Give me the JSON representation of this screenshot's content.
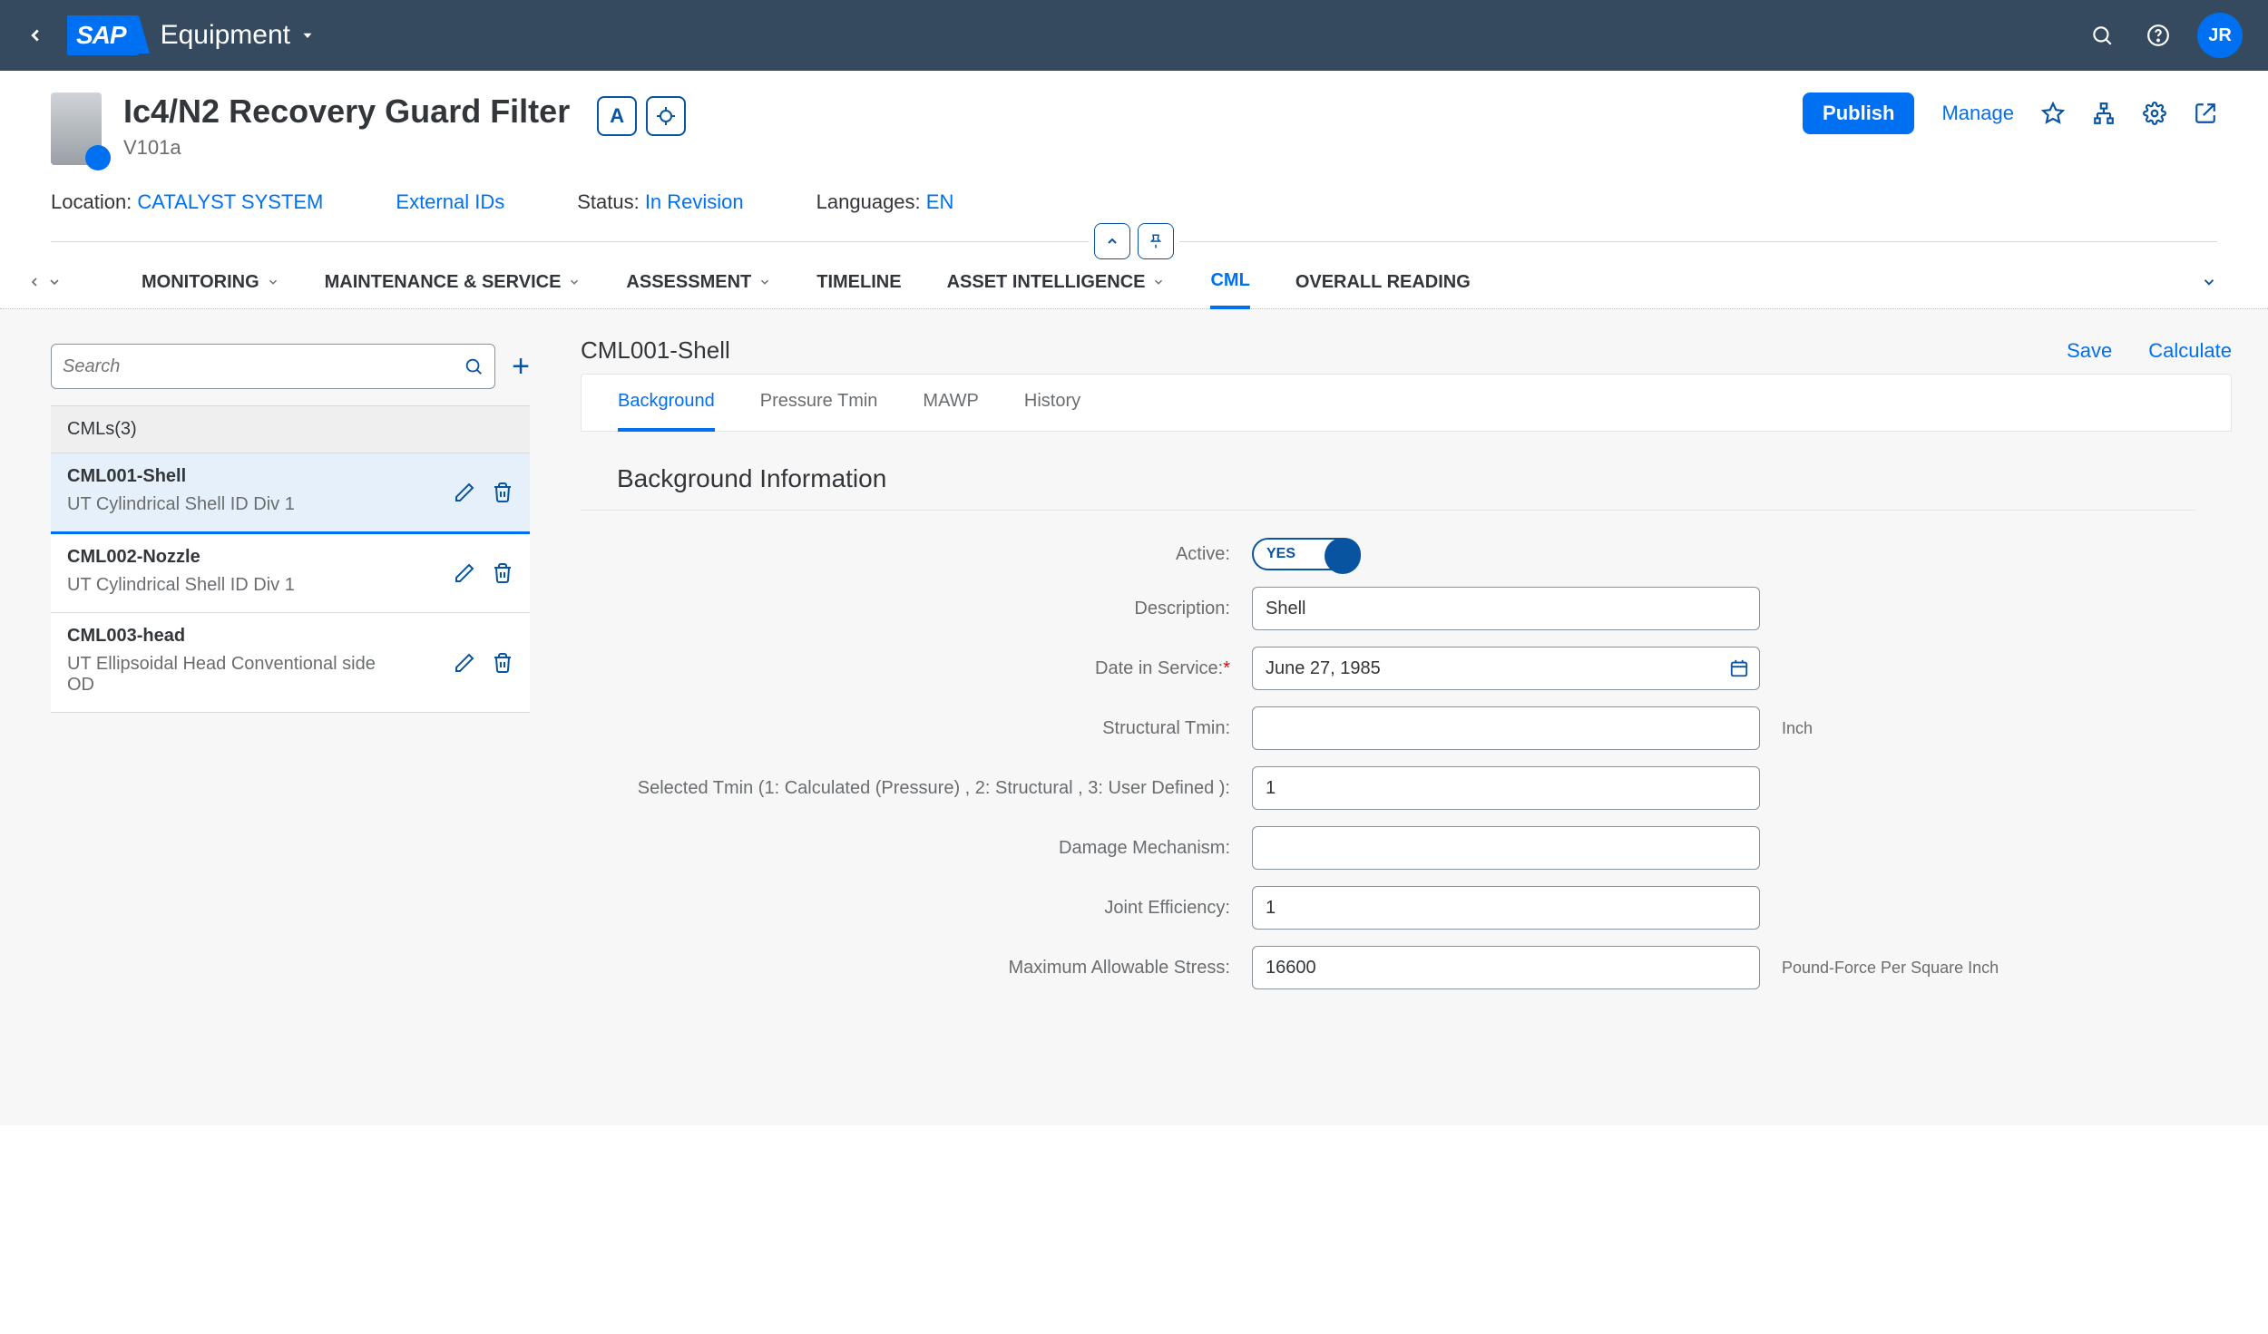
{
  "shell": {
    "app_title": "Equipment",
    "user_initials": "JR"
  },
  "object": {
    "title": "Ic4/N2 Recovery Guard Filter",
    "subtitle": "V101a",
    "badge_A": "A",
    "publish": "Publish",
    "manage": "Manage"
  },
  "meta": {
    "location_label": "Location: ",
    "location_value": "CATALYST SYSTEM",
    "external_ids": "External IDs",
    "status_label": "Status: ",
    "status_value": "In Revision",
    "lang_label": "Languages: ",
    "lang_value": "EN"
  },
  "tabs": {
    "monitoring": "MONITORING",
    "maintenance": "MAINTENANCE & SERVICE",
    "assessment": "ASSESSMENT",
    "timeline": "TIMELINE",
    "asset_intel": "ASSET INTELLIGENCE",
    "cml": "CML",
    "overall": "OVERALL READING"
  },
  "side": {
    "search_placeholder": "Search",
    "list_header": "CMLs(3)",
    "items": [
      {
        "title": "CML001-Shell",
        "sub": "UT Cylindrical Shell ID Div 1"
      },
      {
        "title": "CML002-Nozzle",
        "sub": "UT Cylindrical Shell ID Div 1"
      },
      {
        "title": "CML003-head",
        "sub": "UT Ellipsoidal Head Conventional side OD"
      }
    ]
  },
  "detail": {
    "title": "CML001-Shell",
    "save": "Save",
    "calculate": "Calculate",
    "subtabs": {
      "background": "Background",
      "pressure": "Pressure Tmin",
      "mawp": "MAWP",
      "history": "History"
    },
    "section_title": "Background Information",
    "form": {
      "active_label": "Active:",
      "active_value": "YES",
      "description_label": "Description:",
      "description_value": "Shell",
      "date_label": "Date in Service:",
      "date_value": "June 27, 1985",
      "structural_label": "Structural Tmin:",
      "structural_value": "",
      "structural_unit": "Inch",
      "selected_tmin_label": "Selected Tmin (1: Calculated (Pressure) , 2: Structural , 3: User Defined ):",
      "selected_tmin_value": "1",
      "damage_label": "Damage Mechanism:",
      "damage_value": "",
      "joint_label": "Joint Efficiency:",
      "joint_value": "1",
      "max_stress_label": "Maximum Allowable Stress:",
      "max_stress_value": "16600",
      "max_stress_unit": "Pound-Force Per Square Inch"
    }
  }
}
